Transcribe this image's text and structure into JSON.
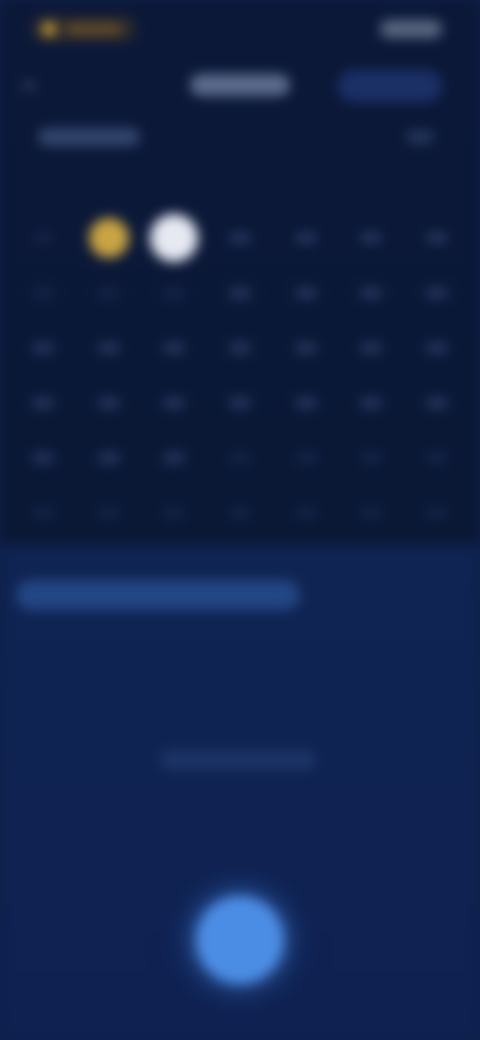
{
  "colors": {
    "header_bg": "#0b1838",
    "body_bg": "#0f2151",
    "selected_day": "#e6e9f2",
    "today_day": "#c9a542",
    "progress_bar": "#234684",
    "fab": "#4b8de4"
  },
  "status": {
    "left_icon": "status-pill-icon",
    "right_icon": "status-indicator-icon"
  },
  "header": {
    "left_icon": "back-arrow-icon",
    "right_icon": "action-pill-icon"
  },
  "calendar": {
    "rows": [
      [
        "",
        "",
        "",
        "",
        "",
        "",
        ""
      ],
      [
        "",
        "",
        "",
        "",
        "",
        "",
        ""
      ],
      [
        "",
        "",
        "",
        "",
        "",
        "",
        ""
      ],
      [
        "",
        "",
        "",
        "",
        "",
        "",
        ""
      ],
      [
        "",
        "",
        "",
        "",
        "",
        "",
        ""
      ],
      [
        "",
        "",
        "",
        "",
        "",
        "",
        ""
      ]
    ]
  },
  "fab": {
    "icon": "add-icon"
  }
}
